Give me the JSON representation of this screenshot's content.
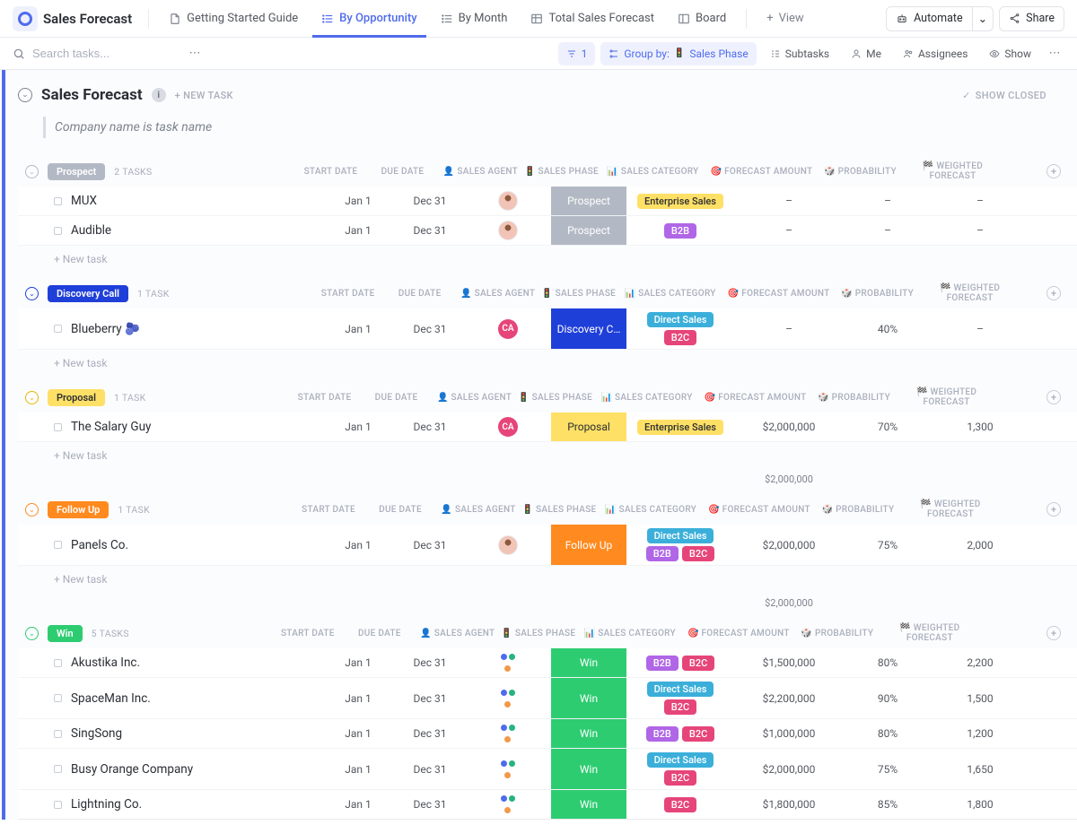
{
  "header": {
    "workspace_title": "Sales Forecast",
    "tabs": [
      {
        "label": "Getting Started Guide"
      },
      {
        "label": "By Opportunity"
      },
      {
        "label": "By Month"
      },
      {
        "label": "Total Sales Forecast"
      },
      {
        "label": "Board"
      },
      {
        "label": "View"
      }
    ],
    "automate": "Automate",
    "share": "Share"
  },
  "toolbar": {
    "search_placeholder": "Search tasks...",
    "filter_count": "1",
    "group_by_label": "Group by:",
    "group_by_value": "Sales Phase",
    "subtasks": "Subtasks",
    "me": "Me",
    "assignees": "Assignees",
    "show": "Show"
  },
  "section": {
    "title": "Sales Forecast",
    "new_task": "+ NEW TASK",
    "show_closed": "SHOW CLOSED",
    "note": "Company name is task name"
  },
  "columns": {
    "start": "START DATE",
    "due": "DUE DATE",
    "agent": "👤 SALES AGENT",
    "phase": "🚦 SALES PHASE",
    "cat": "📊 SALES CATEGORY",
    "forecast": "🎯 FORECAST AMOUNT",
    "prob": "🎲 PROBABILITY",
    "weighted": "🏁 WEIGHTED FORECAST"
  },
  "tag_colors": {
    "Enterprise Sales": {
      "bg": "#ffe066",
      "fg": "#2a2e34"
    },
    "B2B": {
      "bg": "#b066e6",
      "fg": "#ffffff"
    },
    "Direct Sales": {
      "bg": "#3bafda",
      "fg": "#ffffff"
    },
    "B2C": {
      "bg": "#e6457a",
      "fg": "#ffffff"
    }
  },
  "add_task_label": "+ New task",
  "groups": [
    {
      "name": "Prospect",
      "count_label": "2 TASKS",
      "pill_bg": "#b3b9c4",
      "toggle_color": "#b3b9c4",
      "phase_bg": "#b3b9c4",
      "tasks": [
        {
          "title": "MUX",
          "start": "Jan 1",
          "due": "Dec 31",
          "agent_type": "photo",
          "phase": "Prospect",
          "cats": [
            [
              "Enterprise Sales"
            ]
          ],
          "forecast": "–",
          "prob": "–",
          "weighted": "–"
        },
        {
          "title": "Audible",
          "start": "Jan 1",
          "due": "Dec 31",
          "agent_type": "photo",
          "phase": "Prospect",
          "cats": [
            [
              "B2B"
            ]
          ],
          "forecast": "–",
          "prob": "–",
          "weighted": "–"
        }
      ]
    },
    {
      "name": "Discovery Call",
      "count_label": "1 TASK",
      "pill_bg": "#1f3fd9",
      "toggle_color": "#1f3fd9",
      "phase_bg": "#1f3fd9",
      "tasks": [
        {
          "title": "Blueberry 🫐",
          "start": "Jan 1",
          "due": "Dec 31",
          "agent_type": "text",
          "agent_text": "CA",
          "agent_bg": "#e6457a",
          "phase": "Discovery C…",
          "cats": [
            [
              "Direct Sales"
            ],
            [
              "B2C"
            ]
          ],
          "forecast": "–",
          "prob": "40%",
          "weighted": "–"
        }
      ]
    },
    {
      "name": "Proposal",
      "count_label": "1 TASK",
      "pill_bg": "#ffe066",
      "pill_fg": "#2a2e34",
      "toggle_color": "#e6b800",
      "phase_bg": "#ffe066",
      "phase_fg": "#2a2e34",
      "tasks": [
        {
          "title": "The Salary Guy",
          "start": "Jan 1",
          "due": "Dec 31",
          "agent_type": "text",
          "agent_text": "CA",
          "agent_bg": "#e6457a",
          "phase": "Proposal",
          "cats": [
            [
              "Enterprise Sales"
            ]
          ],
          "forecast": "$2,000,000",
          "prob": "70%",
          "weighted": "1,300"
        }
      ],
      "subtotal_forecast": "$2,000,000"
    },
    {
      "name": "Follow Up",
      "count_label": "1 TASK",
      "pill_bg": "#ff8a1f",
      "toggle_color": "#ff8a1f",
      "phase_bg": "#ff8a1f",
      "tasks": [
        {
          "title": "Panels Co.",
          "start": "Jan 1",
          "due": "Dec 31",
          "agent_type": "photo",
          "phase": "Follow Up",
          "cats": [
            [
              "Direct Sales"
            ],
            [
              "B2B",
              "B2C"
            ]
          ],
          "forecast": "$2,000,000",
          "prob": "75%",
          "weighted": "2,000"
        }
      ],
      "subtotal_forecast": "$2,000,000"
    },
    {
      "name": "Win",
      "count_label": "5 TASKS",
      "pill_bg": "#2ecc71",
      "toggle_color": "#2ecc71",
      "phase_bg": "#2ecc71",
      "no_add": true,
      "tasks": [
        {
          "title": "Akustika Inc.",
          "start": "Jan 1",
          "due": "Dec 31",
          "agent_type": "multi",
          "phase": "Win",
          "cats": [
            [
              "B2B",
              "B2C"
            ]
          ],
          "forecast": "$1,500,000",
          "prob": "80%",
          "weighted": "2,200"
        },
        {
          "title": "SpaceMan Inc.",
          "start": "Jan 1",
          "due": "Dec 31",
          "agent_type": "multi",
          "phase": "Win",
          "cats": [
            [
              "Direct Sales"
            ],
            [
              "B2C"
            ]
          ],
          "forecast": "$2,200,000",
          "prob": "90%",
          "weighted": "1,500"
        },
        {
          "title": "SingSong",
          "start": "Jan 1",
          "due": "Dec 31",
          "agent_type": "multi",
          "phase": "Win",
          "cats": [
            [
              "B2B",
              "B2C"
            ]
          ],
          "forecast": "$1,000,000",
          "prob": "80%",
          "weighted": "1,200"
        },
        {
          "title": "Busy Orange Company",
          "start": "Jan 1",
          "due": "Dec 31",
          "agent_type": "multi",
          "phase": "Win",
          "cats": [
            [
              "Direct Sales"
            ],
            [
              "B2C"
            ]
          ],
          "forecast": "$2,000,000",
          "prob": "75%",
          "weighted": "1,650"
        },
        {
          "title": "Lightning Co.",
          "start": "Jan 1",
          "due": "Dec 31",
          "agent_type": "multi",
          "phase": "Win",
          "cats": [
            [
              "B2C"
            ]
          ],
          "forecast": "$1,800,000",
          "prob": "85%",
          "weighted": "1,800"
        }
      ]
    }
  ]
}
